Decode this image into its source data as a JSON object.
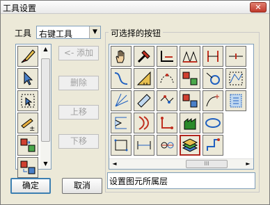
{
  "window": {
    "title": "工具设置",
    "close_label": "✕"
  },
  "tool_selector": {
    "label": "工具",
    "value": "右键工具",
    "arrow": "▼"
  },
  "left_tools": [
    {
      "icon": "brush-eraser-icon"
    },
    {
      "icon": "pointer-arrow-icon"
    },
    {
      "icon": "select-rect-arrow-icon"
    },
    {
      "icon": "pencil-add-icon"
    },
    {
      "icon": "swap-red-green-icon"
    },
    {
      "icon": "swap-blue-icon"
    }
  ],
  "middle_buttons": {
    "add": "<- 添加",
    "delete": "删除",
    "move_up": "上移",
    "move_down": "下移"
  },
  "group": {
    "title": "可选择的按钮"
  },
  "tool_grid": [
    {
      "icon": "hand-icon"
    },
    {
      "icon": "hammer-icon"
    },
    {
      "icon": "corner-line-icon"
    },
    {
      "icon": "triangles-icon"
    },
    {
      "icon": "bar-marks-icon"
    },
    {
      "icon": "dash-line-icon"
    },
    {
      "icon": "curve-icon"
    },
    {
      "icon": "ruler-triangle-icon"
    },
    {
      "icon": "dotted-arc-icon"
    },
    {
      "icon": "swap-red-green-icon"
    },
    {
      "icon": "circle-arrow-icon"
    },
    {
      "icon": "nodes-icon"
    },
    {
      "icon": "fan-lines-icon"
    },
    {
      "icon": "ruler-icon"
    },
    {
      "icon": "node-chain-icon"
    },
    {
      "icon": "swap-blue-icon"
    },
    {
      "icon": "curve-sparkle-icon"
    },
    {
      "icon": "shield-box-icon"
    },
    {
      "icon": "bracket-shape-icon"
    },
    {
      "icon": "double-arc-icon"
    },
    {
      "icon": "red-axis-icon"
    },
    {
      "icon": "green-building-icon"
    },
    {
      "icon": "blue-ellipse-icon"
    },
    {
      "icon": "blank-icon"
    },
    {
      "icon": "dotted-rect-icon"
    },
    {
      "icon": "span-line-icon"
    },
    {
      "icon": "circle-connect-icon"
    },
    {
      "icon": "layers-icon"
    },
    {
      "icon": "corner-marker-icon"
    }
  ],
  "selected_index": 27,
  "scrollbar": {
    "thumb_grip": "III",
    "left": "◄",
    "right": "►",
    "up": "▲",
    "down": "▼"
  },
  "description": "设置图元所属层",
  "buttons": {
    "ok": "确定",
    "cancel": "取消"
  },
  "colors": {
    "accent": "#3c7fb1",
    "selected": "#b0261e",
    "panel": "#ece9d8"
  }
}
